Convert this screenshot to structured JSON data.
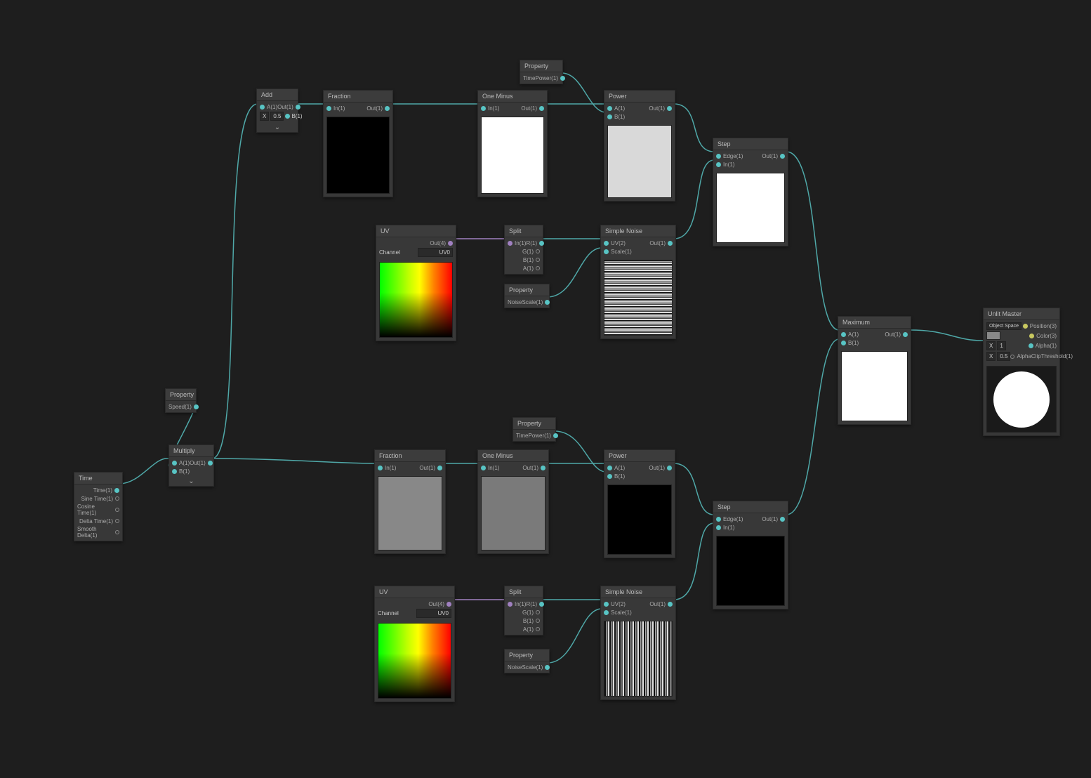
{
  "nodes": {
    "time": {
      "title": "Time",
      "outs": [
        "Time(1)",
        "Sine Time(1)",
        "Cosine Time(1)",
        "Delta Time(1)",
        "Smooth Delta(1)"
      ]
    },
    "prop_speed": {
      "title": "Property",
      "out": "Speed(1)"
    },
    "multiply": {
      "title": "Multiply",
      "inA": "A(1)",
      "inB": "B(1)",
      "out": "Out(1)"
    },
    "add": {
      "title": "Add",
      "inA": "A(1)",
      "inB": "B(1)",
      "out": "Out(1)",
      "x": "X"
    },
    "fraction1": {
      "title": "Fraction",
      "in": "In(1)",
      "out": "Out(1)"
    },
    "oneminus1": {
      "title": "One Minus",
      "in": "In(1)",
      "out": "Out(1)"
    },
    "prop_tp1": {
      "title": "Property",
      "out": "TimePower(1)"
    },
    "power1": {
      "title": "Power",
      "inA": "A(1)",
      "inB": "B(1)",
      "out": "Out(1)"
    },
    "uv1": {
      "title": "UV",
      "out": "Out(4)",
      "channel_label": "Channel",
      "channel_value": "UV0"
    },
    "split1": {
      "title": "Split",
      "in": "In(1)",
      "outs": [
        "R(1)",
        "G(1)",
        "B(1)",
        "A(1)"
      ]
    },
    "prop_ns1": {
      "title": "Property",
      "out": "NoiseScale(1)"
    },
    "snoise1": {
      "title": "Simple Noise",
      "inUV": "UV(2)",
      "inScale": "Scale(1)",
      "out": "Out(1)"
    },
    "step1": {
      "title": "Step",
      "inEdge": "Edge(1)",
      "inIn": "In(1)",
      "out": "Out(1)"
    },
    "fraction2": {
      "title": "Fraction",
      "in": "In(1)",
      "out": "Out(1)"
    },
    "oneminus2": {
      "title": "One Minus",
      "in": "In(1)",
      "out": "Out(1)"
    },
    "prop_tp2": {
      "title": "Property",
      "out": "TimePower(1)"
    },
    "power2": {
      "title": "Power",
      "inA": "A(1)",
      "inB": "B(1)",
      "out": "Out(1)"
    },
    "uv2": {
      "title": "UV",
      "out": "Out(4)",
      "channel_label": "Channel",
      "channel_value": "UV0"
    },
    "split2": {
      "title": "Split",
      "in": "In(1)",
      "outs": [
        "R(1)",
        "G(1)",
        "B(1)",
        "A(1)"
      ]
    },
    "prop_ns2": {
      "title": "Property",
      "out": "NoiseScale(1)"
    },
    "snoise2": {
      "title": "Simple Noise",
      "inUV": "UV(2)",
      "inScale": "Scale(1)",
      "out": "Out(1)"
    },
    "step2": {
      "title": "Step",
      "inEdge": "Edge(1)",
      "inIn": "In(1)",
      "out": "Out(1)"
    },
    "maximum": {
      "title": "Maximum",
      "inA": "A(1)",
      "inB": "B(1)",
      "out": "Out(1)"
    },
    "master": {
      "title": "Unlit Master",
      "pos_label": "Position(3)",
      "color_label": "Color(3)",
      "alpha_label": "Alpha(1)",
      "clip_label": "AlphaClipThreshold(1)",
      "space": "Object Space",
      "x": "X"
    }
  },
  "colors": {
    "wire": "#4fa8a8",
    "wire_purple": "#a080c0"
  }
}
